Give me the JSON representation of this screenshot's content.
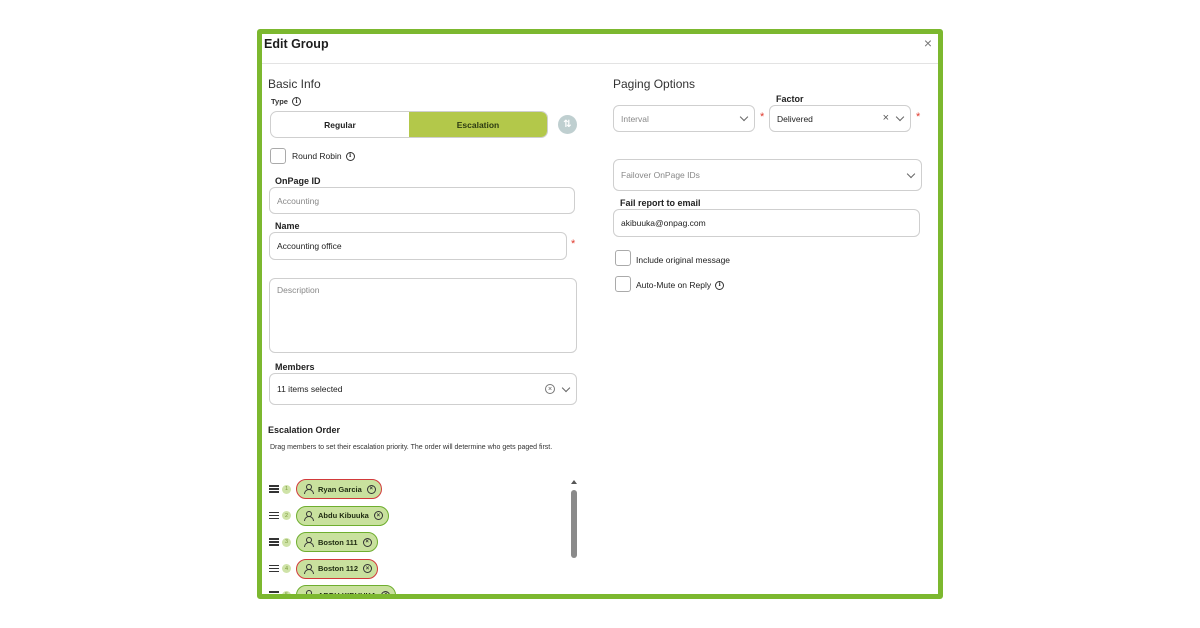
{
  "dialog": {
    "title": "Edit Group",
    "close_glyph": "×"
  },
  "basic_info": {
    "heading": "Basic Info",
    "type_label": "Type",
    "type_options": [
      "Regular",
      "Escalation"
    ],
    "type_selected": "Escalation",
    "round_robin_label": "Round Robin",
    "onpage_id_label": "OnPage ID",
    "onpage_id_placeholder": "Accounting",
    "name_label": "Name",
    "name_value": "Accounting office",
    "description_placeholder": "Description",
    "members_label": "Members",
    "members_value": "11 items selected",
    "escalation_heading": "Escalation Order",
    "escalation_desc": "Drag members to set their escalation priority. The order will determine who gets paged first.",
    "escalation_list": [
      {
        "num": "1",
        "name": "Ryan Garcia",
        "status": "red"
      },
      {
        "num": "2",
        "name": "Abdu Kibuuka",
        "status": "green"
      },
      {
        "num": "3",
        "name": "Boston 111",
        "status": "green"
      },
      {
        "num": "4",
        "name": "Boston 112",
        "status": "red"
      },
      {
        "num": "5",
        "name": "ABDU KIBUUKA",
        "status": "green"
      }
    ]
  },
  "paging": {
    "heading": "Paging Options",
    "interval_placeholder": "Interval",
    "factor_label": "Factor",
    "factor_value": "Delivered",
    "failover_placeholder": "Failover OnPage IDs",
    "fail_report_label": "Fail report to email",
    "fail_report_value": "akibuuka@onpag.com",
    "include_original_label": "Include original message",
    "auto_mute_label": "Auto-Mute on Reply"
  },
  "colors": {
    "frame_border": "#7cb82f",
    "accent": "#b3c84a",
    "required": "#e03a2e",
    "chip_bg": "#c9e19e",
    "chip_border_green": "#6fae2f",
    "chip_border_red": "#d23a3a"
  }
}
